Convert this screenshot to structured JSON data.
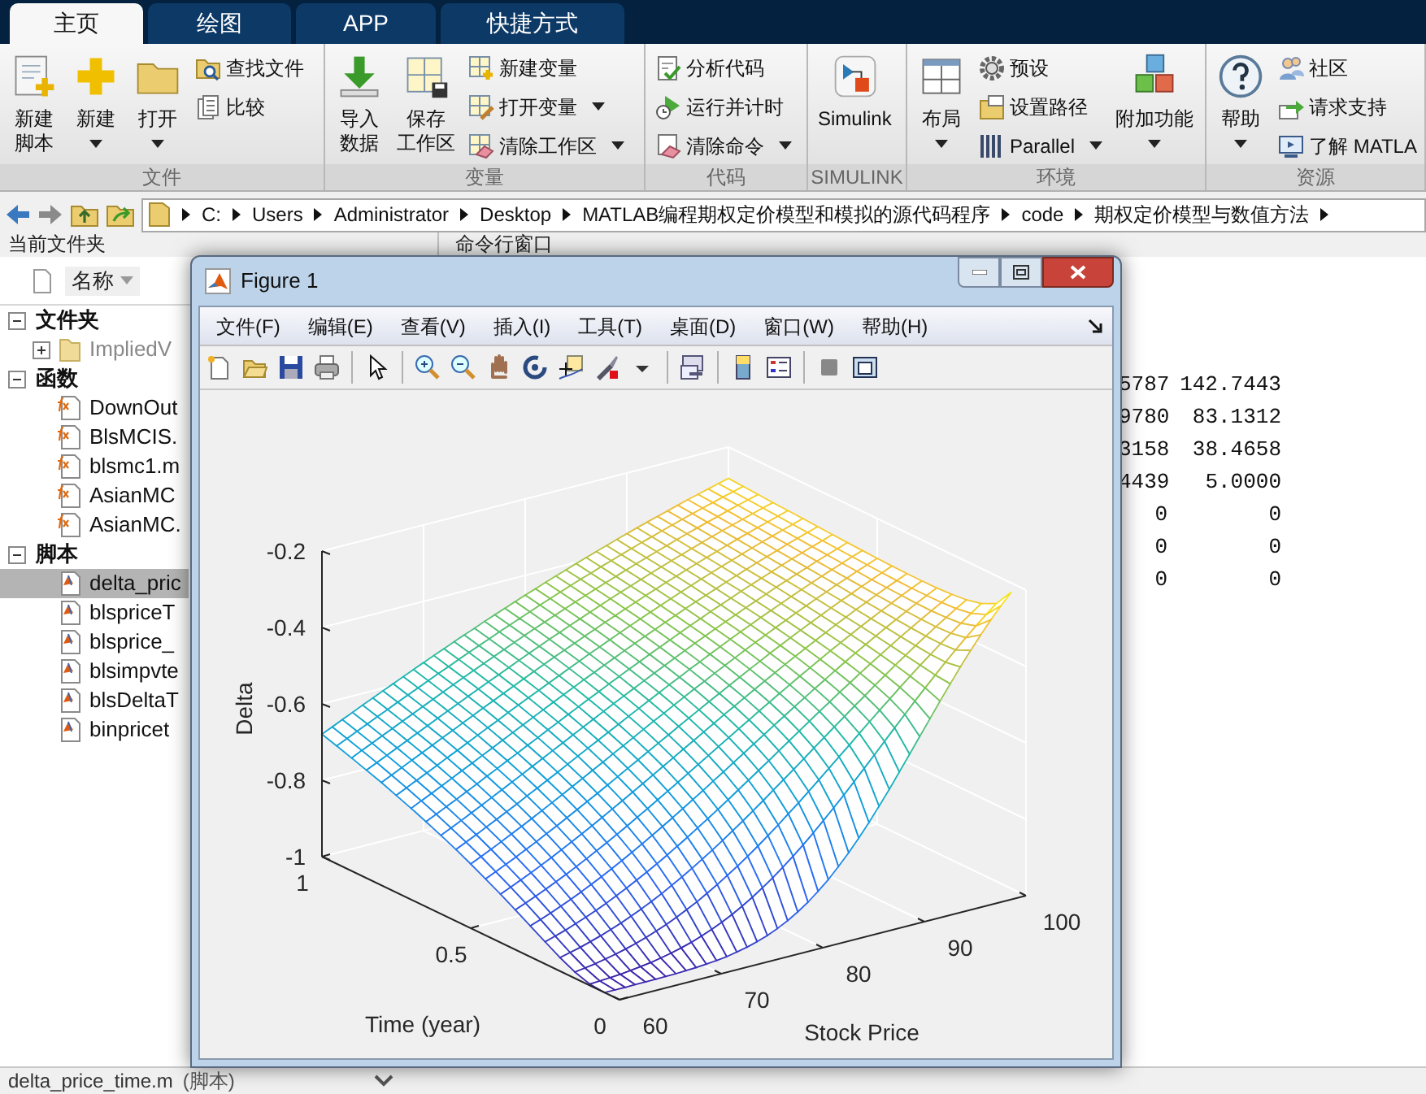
{
  "tabs": [
    {
      "label": "主页",
      "selected": true
    },
    {
      "label": "绘图",
      "selected": false
    },
    {
      "label": "APP",
      "selected": false
    },
    {
      "label": "快捷方式",
      "selected": false
    }
  ],
  "ribbon": {
    "groups": [
      {
        "label": "文件",
        "items": [
          {
            "kind": "large",
            "lines": [
              "新建",
              "脚本"
            ],
            "menu": false
          },
          {
            "kind": "large",
            "lines": [
              "新建"
            ],
            "menu": true
          },
          {
            "kind": "large",
            "lines": [
              "打开"
            ],
            "menu": true
          },
          {
            "kind": "small",
            "label": "查找文件",
            "menu": false
          },
          {
            "kind": "small",
            "label": "比较",
            "menu": false
          }
        ]
      },
      {
        "label": "变量",
        "items": [
          {
            "kind": "large",
            "lines": [
              "导入",
              "数据"
            ],
            "menu": false
          },
          {
            "kind": "large",
            "lines": [
              "保存",
              "工作区"
            ],
            "menu": false
          },
          {
            "kind": "small",
            "label": "新建变量",
            "menu": false
          },
          {
            "kind": "small",
            "label": "打开变量",
            "menu": true
          },
          {
            "kind": "small",
            "label": "清除工作区",
            "menu": true
          }
        ]
      },
      {
        "label": "代码",
        "items": [
          {
            "kind": "small",
            "label": "分析代码",
            "menu": false
          },
          {
            "kind": "small",
            "label": "运行并计时",
            "menu": false
          },
          {
            "kind": "small",
            "label": "清除命令",
            "menu": true
          }
        ]
      },
      {
        "label": "SIMULINK",
        "items": [
          {
            "kind": "large",
            "lines": [
              "Simulink"
            ],
            "menu": false
          }
        ]
      },
      {
        "label": "环境",
        "items": [
          {
            "kind": "large",
            "lines": [
              "布局"
            ],
            "menu": true
          },
          {
            "kind": "small",
            "label": "预设",
            "menu": false
          },
          {
            "kind": "small",
            "label": "设置路径",
            "menu": false
          },
          {
            "kind": "small",
            "label": "Parallel",
            "menu": true
          },
          {
            "kind": "large",
            "lines": [
              "附加功能"
            ],
            "menu": true
          }
        ]
      },
      {
        "label": "资源",
        "items": [
          {
            "kind": "large",
            "lines": [
              "帮助"
            ],
            "menu": true
          },
          {
            "kind": "small",
            "label": "社区",
            "menu": false
          },
          {
            "kind": "small",
            "label": "请求支持",
            "menu": false
          },
          {
            "kind": "small",
            "label": "了解 MATLA",
            "menu": false
          }
        ]
      }
    ]
  },
  "address_bar": {
    "path": [
      "C:",
      "Users",
      "Administrator",
      "Desktop",
      "MATLAB编程期权定价模型和模拟的源代码程序",
      "code",
      "期权定价模型与数值方法"
    ]
  },
  "current_folder": {
    "title": "当前文件夹",
    "column": "名称",
    "tree": [
      {
        "kind": "section",
        "label": "文件夹",
        "expanded": true,
        "children": [
          {
            "kind": "folder",
            "label": "ImpliedV",
            "expanded": false,
            "selected": false
          }
        ]
      },
      {
        "kind": "section",
        "label": "函数",
        "expanded": true,
        "children": [
          {
            "kind": "function",
            "label": "DownOut",
            "selected": false
          },
          {
            "kind": "function",
            "label": "BlsMCIS.",
            "selected": false
          },
          {
            "kind": "function",
            "label": "blsmc1.m",
            "selected": false
          },
          {
            "kind": "function",
            "label": "AsianMC",
            "selected": false
          },
          {
            "kind": "function",
            "label": "AsianMC.",
            "selected": false
          }
        ]
      },
      {
        "kind": "section",
        "label": "脚本",
        "expanded": true,
        "children": [
          {
            "kind": "script",
            "label": "delta_pric",
            "selected": true
          },
          {
            "kind": "script",
            "label": "blspriceT",
            "selected": false
          },
          {
            "kind": "script",
            "label": "blsprice_",
            "selected": false
          },
          {
            "kind": "script",
            "label": "blsimpvte",
            "selected": false
          },
          {
            "kind": "script",
            "label": "blsDeltaT",
            "selected": false
          },
          {
            "kind": "script",
            "label": "binpricet",
            "selected": false
          }
        ]
      }
    ]
  },
  "command_window": {
    "title": "命令行窗口",
    "rows": [
      [
        "5787",
        "142.7443"
      ],
      [
        "9780",
        "83.1312"
      ],
      [
        "3158",
        "38.4658"
      ],
      [
        "4439",
        "5.0000"
      ],
      [
        "0",
        "0"
      ],
      [
        "0",
        "0"
      ],
      [
        "0",
        "0"
      ]
    ]
  },
  "figure": {
    "title": "Figure 1",
    "menus": [
      "文件(F)",
      "编辑(E)",
      "查看(V)",
      "插入(I)",
      "工具(T)",
      "桌面(D)",
      "窗口(W)",
      "帮助(H)"
    ],
    "plot": {
      "zlabel": "Delta",
      "zticks": [
        "-0.2",
        "-0.4",
        "-0.6",
        "-0.8",
        "-1"
      ],
      "ylabel": "Time (year)",
      "yticks": [
        "1",
        "0.5",
        "0"
      ],
      "xlabel": "Stock Price",
      "xticks": [
        "60",
        "70",
        "80",
        "90",
        "100"
      ]
    }
  },
  "status_bar": {
    "file": "delta_price_time.m",
    "type": "(脚本)"
  }
}
